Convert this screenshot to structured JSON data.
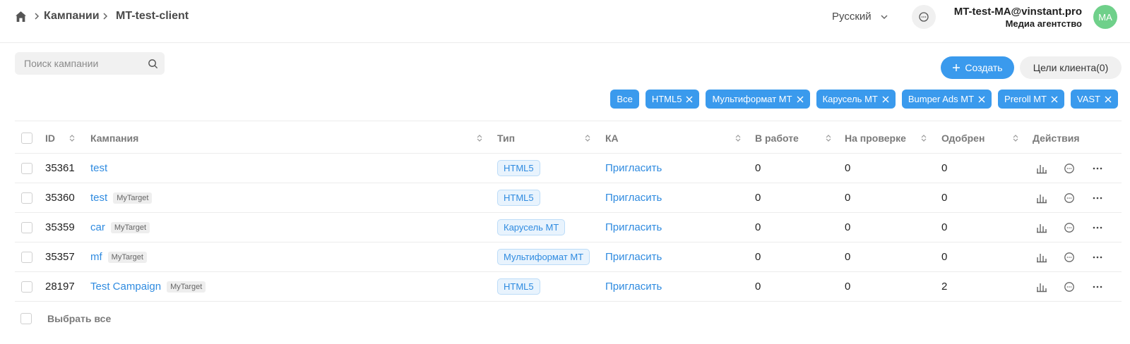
{
  "breadcrumb": {
    "items": [
      "Кампании",
      "MT-test-client"
    ]
  },
  "header": {
    "language": "Русский",
    "user_email": "MT-test-MA@vinstant.pro",
    "user_role": "Медиа агентство",
    "avatar_initials": "MA"
  },
  "toolbar": {
    "search_placeholder": "Поиск кампании",
    "create_label": "Создать",
    "goals_label": "Цели клиента(0)"
  },
  "filters": {
    "all_label": "Все",
    "chips": [
      "HTML5",
      "Мультиформат МТ",
      "Карусель МТ",
      "Bumper Ads МТ",
      "Preroll MT",
      "VAST"
    ]
  },
  "table": {
    "columns": {
      "id": "ID",
      "campaign": "Кампания",
      "type": "Тип",
      "ka": "КА",
      "in_work": "В работе",
      "review": "На проверке",
      "approved": "Одобрен",
      "actions": "Действия"
    },
    "rows": [
      {
        "id": "35361",
        "name": "test",
        "source": "",
        "type": "HTML5",
        "ka": "Пригласить",
        "in_work": "0",
        "review": "0",
        "approved": "0"
      },
      {
        "id": "35360",
        "name": "test",
        "source": "MyTarget",
        "type": "HTML5",
        "ka": "Пригласить",
        "in_work": "0",
        "review": "0",
        "approved": "0"
      },
      {
        "id": "35359",
        "name": "car",
        "source": "MyTarget",
        "type": "Карусель МТ",
        "ka": "Пригласить",
        "in_work": "0",
        "review": "0",
        "approved": "0"
      },
      {
        "id": "35357",
        "name": "mf",
        "source": "MyTarget",
        "type": "Мультиформат МТ",
        "ka": "Пригласить",
        "in_work": "0",
        "review": "0",
        "approved": "0"
      },
      {
        "id": "28197",
        "name": "Test Campaign",
        "source": "MyTarget",
        "type": "HTML5",
        "ka": "Пригласить",
        "in_work": "0",
        "review": "0",
        "approved": "2"
      }
    ],
    "select_all_label": "Выбрать все"
  },
  "colors": {
    "accent": "#3a9aed",
    "link": "#2f8be0",
    "avatar": "#6fd08a"
  }
}
